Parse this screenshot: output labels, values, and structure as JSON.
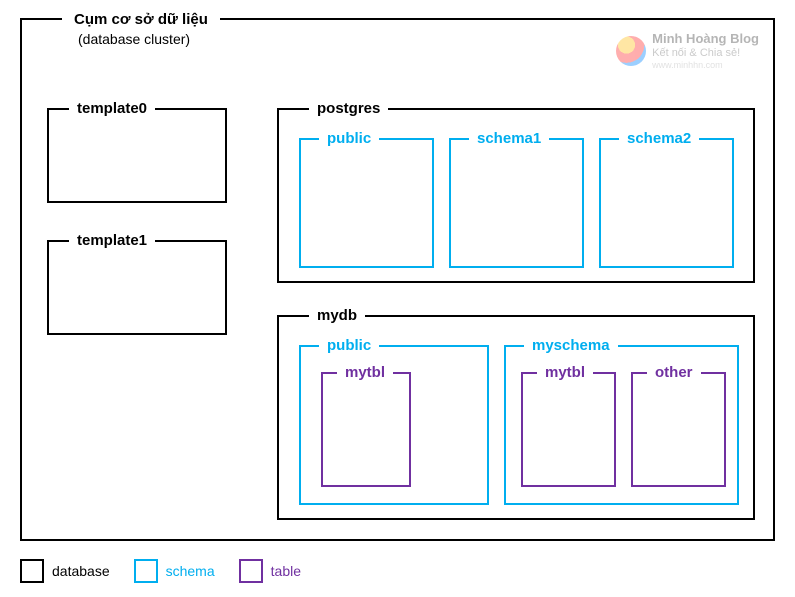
{
  "cluster": {
    "title": "Cụm cơ sở dữ liệu",
    "subtitle": "(database cluster)"
  },
  "databases": {
    "template0": {
      "label": "template0"
    },
    "template1": {
      "label": "template1"
    },
    "postgres": {
      "label": "postgres",
      "schemas": {
        "public": {
          "label": "public"
        },
        "schema1": {
          "label": "schema1"
        },
        "schema2": {
          "label": "schema2"
        }
      }
    },
    "mydb": {
      "label": "mydb",
      "schemas": {
        "public": {
          "label": "public",
          "tables": {
            "mytbl": {
              "label": "mytbl"
            }
          }
        },
        "myschema": {
          "label": "myschema",
          "tables": {
            "mytbl": {
              "label": "mytbl"
            },
            "other": {
              "label": "other"
            }
          }
        }
      }
    }
  },
  "legend": {
    "database": "database",
    "schema": "schema",
    "table": "table"
  },
  "watermark": {
    "line1": "Minh Hoàng Blog",
    "line2": "Kết nối & Chia sẻ!",
    "line3": "www.minhhn.com"
  },
  "colors": {
    "database_border": "#000000",
    "schema_border": "#00aeef",
    "table_border": "#7030a0"
  }
}
